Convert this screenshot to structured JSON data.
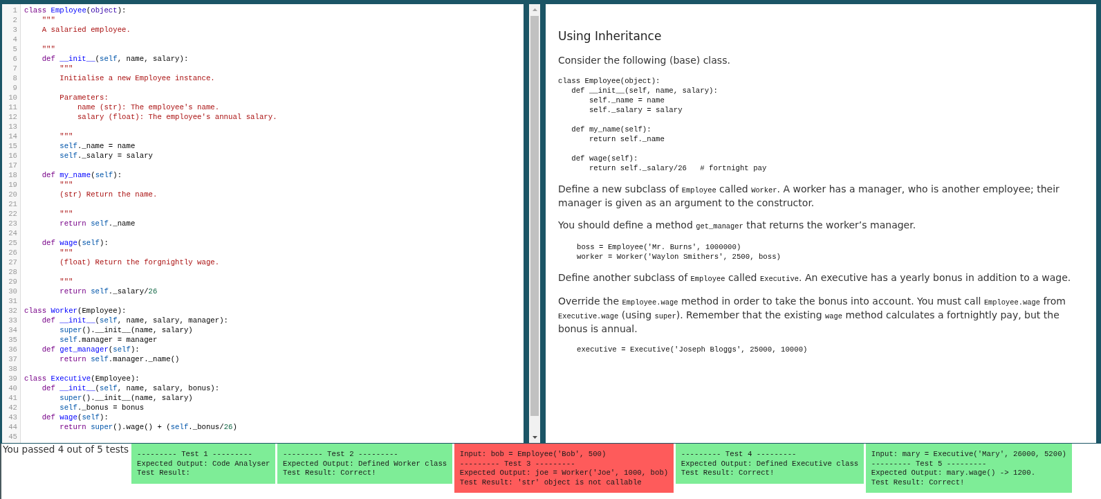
{
  "editor": {
    "lines": [
      {
        "number": "1",
        "tokens": [
          {
            "kind": "keyword",
            "text": "class "
          },
          {
            "kind": "definition",
            "text": "Employee"
          },
          {
            "kind": "plain",
            "text": "("
          },
          {
            "kind": "builtin",
            "text": "object"
          },
          {
            "kind": "plain",
            "text": "):"
          }
        ],
        "children": [
          {
            "number": "2",
            "tokens": [
              {
                "kind": "string",
                "text": "\"\"\""
              }
            ]
          },
          {
            "number": "3",
            "tokens": [
              {
                "kind": "string",
                "text": "A salaried employee."
              }
            ]
          },
          {
            "number": "4"
          },
          {
            "number": "5",
            "tokens": [
              {
                "kind": "string",
                "text": "\"\"\""
              }
            ]
          },
          {
            "number": "6",
            "tokens": [
              {
                "kind": "keyword",
                "text": "def "
              },
              {
                "kind": "definition",
                "text": "__init__"
              },
              {
                "kind": "plain",
                "text": "("
              },
              {
                "kind": "variable",
                "text": "self"
              },
              {
                "kind": "plain",
                "text": ", name, salary):"
              }
            ],
            "children": [
              {
                "number": "7",
                "tokens": [
                  {
                    "kind": "string",
                    "text": "\"\"\""
                  }
                ]
              },
              {
                "number": "8",
                "tokens": [
                  {
                    "kind": "string",
                    "text": "Initialise a new Employee instance."
                  }
                ]
              },
              {
                "number": "9"
              },
              {
                "number": "10",
                "tokens": [
                  {
                    "kind": "string",
                    "text": "Parameters:"
                  }
                ],
                "children": [
                  {
                    "number": "11",
                    "tokens": [
                      {
                        "kind": "string",
                        "text": "name (str): The employee's name."
                      }
                    ]
                  },
                  {
                    "number": "12",
                    "tokens": [
                      {
                        "kind": "string",
                        "text": "salary (float): The employee's annual salary."
                      }
                    ]
                  }
                ]
              },
              {
                "number": "13"
              },
              {
                "number": "14",
                "tokens": [
                  {
                    "kind": "string",
                    "text": "\"\"\""
                  }
                ]
              },
              {
                "number": "15",
                "tokens": [
                  {
                    "kind": "variable",
                    "text": "self"
                  },
                  {
                    "kind": "plain",
                    "text": "._name = name"
                  }
                ]
              },
              {
                "number": "16",
                "tokens": [
                  {
                    "kind": "variable",
                    "text": "self"
                  },
                  {
                    "kind": "plain",
                    "text": "._salary = salary"
                  }
                ]
              }
            ]
          },
          {
            "number": "17"
          },
          {
            "number": "18",
            "tokens": [
              {
                "kind": "keyword",
                "text": "def "
              },
              {
                "kind": "definition",
                "text": "my_name"
              },
              {
                "kind": "plain",
                "text": "("
              },
              {
                "kind": "variable",
                "text": "self"
              },
              {
                "kind": "plain",
                "text": "):"
              }
            ],
            "children": [
              {
                "number": "19",
                "tokens": [
                  {
                    "kind": "string",
                    "text": "\"\"\""
                  }
                ]
              },
              {
                "number": "20",
                "tokens": [
                  {
                    "kind": "string",
                    "text": "(str) Return the name."
                  }
                ]
              },
              {
                "number": "21"
              },
              {
                "number": "22",
                "tokens": [
                  {
                    "kind": "string",
                    "text": "\"\"\""
                  }
                ]
              },
              {
                "number": "23",
                "tokens": [
                  {
                    "kind": "keyword",
                    "text": "return "
                  },
                  {
                    "kind": "variable",
                    "text": "self"
                  },
                  {
                    "kind": "plain",
                    "text": "._name"
                  }
                ]
              }
            ]
          },
          {
            "number": "24"
          },
          {
            "number": "25",
            "tokens": [
              {
                "kind": "keyword",
                "text": "def "
              },
              {
                "kind": "definition",
                "text": "wage"
              },
              {
                "kind": "plain",
                "text": "("
              },
              {
                "kind": "variable",
                "text": "self"
              },
              {
                "kind": "plain",
                "text": "):"
              }
            ],
            "children": [
              {
                "number": "26",
                "tokens": [
                  {
                    "kind": "string",
                    "text": "\"\"\""
                  }
                ]
              },
              {
                "number": "27",
                "tokens": [
                  {
                    "kind": "string",
                    "text": "(float) Return the forgnightly wage."
                  }
                ]
              },
              {
                "number": "28"
              },
              {
                "number": "29",
                "tokens": [
                  {
                    "kind": "string",
                    "text": "\"\"\""
                  }
                ]
              },
              {
                "number": "30",
                "tokens": [
                  {
                    "kind": "keyword",
                    "text": "return "
                  },
                  {
                    "kind": "variable",
                    "text": "self"
                  },
                  {
                    "kind": "plain",
                    "text": "._salary/"
                  },
                  {
                    "kind": "number",
                    "text": "26"
                  }
                ]
              }
            ]
          }
        ]
      },
      {
        "number": "31"
      },
      {
        "number": "32",
        "tokens": [
          {
            "kind": "keyword",
            "text": "class "
          },
          {
            "kind": "definition",
            "text": "Worker"
          },
          {
            "kind": "plain",
            "text": "(Employee):"
          }
        ],
        "children": [
          {
            "number": "33",
            "tokens": [
              {
                "kind": "keyword",
                "text": "def "
              },
              {
                "kind": "definition",
                "text": "__init__"
              },
              {
                "kind": "plain",
                "text": "("
              },
              {
                "kind": "variable",
                "text": "self"
              },
              {
                "kind": "plain",
                "text": ", name, salary, manager):"
              }
            ],
            "children": [
              {
                "number": "34",
                "tokens": [
                  {
                    "kind": "variable",
                    "text": "super"
                  },
                  {
                    "kind": "plain",
                    "text": "().__init__(name, salary)"
                  }
                ]
              },
              {
                "number": "35",
                "tokens": [
                  {
                    "kind": "variable",
                    "text": "self"
                  },
                  {
                    "kind": "plain",
                    "text": ".manager = manager"
                  }
                ]
              }
            ]
          },
          {
            "number": "36",
            "tokens": [
              {
                "kind": "keyword",
                "text": "def "
              },
              {
                "kind": "definition",
                "text": "get_manager"
              },
              {
                "kind": "plain",
                "text": "("
              },
              {
                "kind": "variable",
                "text": "self"
              },
              {
                "kind": "plain",
                "text": "):"
              }
            ],
            "children": [
              {
                "number": "37",
                "tokens": [
                  {
                    "kind": "keyword",
                    "text": "return "
                  },
                  {
                    "kind": "variable",
                    "text": "self"
                  },
                  {
                    "kind": "plain",
                    "text": ".manager._name()"
                  }
                ]
              }
            ]
          }
        ]
      },
      {
        "number": "38"
      },
      {
        "number": "39",
        "tokens": [
          {
            "kind": "keyword",
            "text": "class "
          },
          {
            "kind": "definition",
            "text": "Executive"
          },
          {
            "kind": "plain",
            "text": "(Employee):"
          }
        ],
        "children": [
          {
            "number": "40",
            "tokens": [
              {
                "kind": "keyword",
                "text": "def "
              },
              {
                "kind": "definition",
                "text": "__init__"
              },
              {
                "kind": "plain",
                "text": "("
              },
              {
                "kind": "variable",
                "text": "self"
              },
              {
                "kind": "plain",
                "text": ", name, salary, bonus):"
              }
            ],
            "children": [
              {
                "number": "41",
                "tokens": [
                  {
                    "kind": "variable",
                    "text": "super"
                  },
                  {
                    "kind": "plain",
                    "text": "().__init__(name, salary)"
                  }
                ]
              },
              {
                "number": "42",
                "tokens": [
                  {
                    "kind": "variable",
                    "text": "self"
                  },
                  {
                    "kind": "plain",
                    "text": "._bonus = bonus"
                  }
                ]
              }
            ]
          },
          {
            "number": "43",
            "tokens": [
              {
                "kind": "keyword",
                "text": "def "
              },
              {
                "kind": "definition",
                "text": "wage"
              },
              {
                "kind": "plain",
                "text": "("
              },
              {
                "kind": "variable",
                "text": "self"
              },
              {
                "kind": "plain",
                "text": "):"
              }
            ],
            "children": [
              {
                "number": "44",
                "tokens": [
                  {
                    "kind": "keyword",
                    "text": "return "
                  },
                  {
                    "kind": "variable",
                    "text": "super"
                  },
                  {
                    "kind": "plain",
                    "text": "().wage() + ("
                  },
                  {
                    "kind": "variable",
                    "text": "self"
                  },
                  {
                    "kind": "plain",
                    "text": "._bonus/"
                  },
                  {
                    "kind": "number",
                    "text": "26"
                  },
                  {
                    "kind": "plain",
                    "text": ")"
                  }
                ]
              }
            ]
          }
        ]
      },
      {
        "number": "45"
      }
    ]
  },
  "instructions": {
    "title": "Using Inheritance",
    "blocks": [
      {
        "kind": "paragraph",
        "parts": [
          {
            "kind": "text",
            "text": "Consider the following (base) class."
          }
        ]
      },
      {
        "kind": "code",
        "groups": [
          [
            "class Employee(object):",
            "   def __init__(self, name, salary):",
            "       self._name = name",
            "       self._salary = salary"
          ],
          [
            "   def my_name(self):",
            "       return self._name"
          ],
          [
            "   def wage(self):",
            "       return self._salary/26   # fortnight pay"
          ]
        ]
      },
      {
        "kind": "paragraph",
        "parts": [
          {
            "kind": "text",
            "text": "Define a new subclass of "
          },
          {
            "kind": "code",
            "text": "Employee"
          },
          {
            "kind": "text",
            "text": " called "
          },
          {
            "kind": "code",
            "text": "Worker"
          },
          {
            "kind": "text",
            "text": ". A worker has a manager, who is another employee; their manager is given as an argument to the constructor."
          }
        ]
      },
      {
        "kind": "paragraph",
        "parts": [
          {
            "kind": "text",
            "text": "You should define a method "
          },
          {
            "kind": "code",
            "text": "get_manager"
          },
          {
            "kind": "text",
            "text": " that returns the worker’s manager."
          }
        ]
      },
      {
        "kind": "indented_code",
        "groups": [
          [
            "boss = Employee('Mr. Burns', 1000000)",
            "worker = Worker('Waylon Smithers', 2500, boss)"
          ]
        ]
      },
      {
        "kind": "paragraph",
        "parts": [
          {
            "kind": "text",
            "text": "Define another subclass of "
          },
          {
            "kind": "code",
            "text": "Employee"
          },
          {
            "kind": "text",
            "text": " called "
          },
          {
            "kind": "code",
            "text": "Executive"
          },
          {
            "kind": "text",
            "text": ". An executive has a yearly bonus in addition to a wage."
          }
        ]
      },
      {
        "kind": "paragraph",
        "parts": [
          {
            "kind": "text",
            "text": "Override the "
          },
          {
            "kind": "code",
            "text": "Employee.wage"
          },
          {
            "kind": "text",
            "text": " method in order to take the bonus into account. You must call "
          },
          {
            "kind": "code",
            "text": "Employee.wage"
          },
          {
            "kind": "text",
            "text": " from "
          },
          {
            "kind": "code",
            "text": "Executive.wage"
          },
          {
            "kind": "text",
            "text": " (using "
          },
          {
            "kind": "code",
            "text": "super"
          },
          {
            "kind": "text",
            "text": "). Remember that the existing "
          },
          {
            "kind": "code",
            "text": "wage"
          },
          {
            "kind": "text",
            "text": " method calculates a fortnightly pay, but the bonus is annual."
          }
        ]
      },
      {
        "kind": "indented_code",
        "groups": [
          [
            "executive = Executive('Joseph Bloggs', 25000, 10000)"
          ]
        ]
      }
    ]
  },
  "results": {
    "summary": "You passed 4 out of 5 tests",
    "tests": [
      {
        "passed": true,
        "lines": [
          "--------- Test 1 ---------",
          "Expected Output: Code Analyser",
          "Test Result:"
        ]
      },
      {
        "passed": true,
        "lines": [
          "--------- Test 2 ---------",
          "Expected Output: Defined Worker class",
          "Test Result: Correct!"
        ]
      },
      {
        "passed": false,
        "lines": [
          "Input: bob = Employee('Bob', 500)",
          "--------- Test 3 ---------",
          "Expected Output: joe = Worker('Joe', 1000, bob)",
          "Test Result: 'str' object is not callable"
        ]
      },
      {
        "passed": true,
        "lines": [
          "--------- Test 4 ---------",
          "Expected Output: Defined Executive class",
          "Test Result: Correct!"
        ]
      },
      {
        "passed": true,
        "lines": [
          "Input: mary = Executive('Mary', 26000, 5200)",
          "--------- Test 5 ---------",
          "Expected Output: mary.wage() -> 1200.",
          "Test Result: Correct!"
        ]
      }
    ]
  }
}
